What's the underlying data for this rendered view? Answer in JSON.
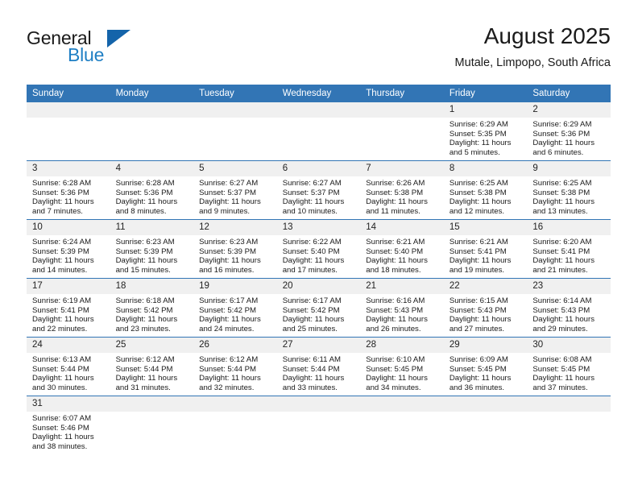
{
  "brand": {
    "word_general": "General",
    "word_blue": "Blue",
    "logo_icon": "triangle-logo-icon",
    "accent_color": "#1f7fc4",
    "triangle_color": "#1464aa"
  },
  "header": {
    "title": "August 2025",
    "subtitle": "Mutale, Limpopo, South Africa"
  },
  "theme": {
    "header_row_bg": "#3275b5",
    "daynum_bg": "#f0f0f0",
    "row_divider": "#3275b5"
  },
  "weekday_headers": [
    "Sunday",
    "Monday",
    "Tuesday",
    "Wednesday",
    "Thursday",
    "Friday",
    "Saturday"
  ],
  "weeks": [
    [
      {
        "day": "",
        "lines": []
      },
      {
        "day": "",
        "lines": []
      },
      {
        "day": "",
        "lines": []
      },
      {
        "day": "",
        "lines": []
      },
      {
        "day": "",
        "lines": []
      },
      {
        "day": "1",
        "lines": [
          "Sunrise: 6:29 AM",
          "Sunset: 5:35 PM",
          "Daylight: 11 hours",
          "and 5 minutes."
        ]
      },
      {
        "day": "2",
        "lines": [
          "Sunrise: 6:29 AM",
          "Sunset: 5:36 PM",
          "Daylight: 11 hours",
          "and 6 minutes."
        ]
      }
    ],
    [
      {
        "day": "3",
        "lines": [
          "Sunrise: 6:28 AM",
          "Sunset: 5:36 PM",
          "Daylight: 11 hours",
          "and 7 minutes."
        ]
      },
      {
        "day": "4",
        "lines": [
          "Sunrise: 6:28 AM",
          "Sunset: 5:36 PM",
          "Daylight: 11 hours",
          "and 8 minutes."
        ]
      },
      {
        "day": "5",
        "lines": [
          "Sunrise: 6:27 AM",
          "Sunset: 5:37 PM",
          "Daylight: 11 hours",
          "and 9 minutes."
        ]
      },
      {
        "day": "6",
        "lines": [
          "Sunrise: 6:27 AM",
          "Sunset: 5:37 PM",
          "Daylight: 11 hours",
          "and 10 minutes."
        ]
      },
      {
        "day": "7",
        "lines": [
          "Sunrise: 6:26 AM",
          "Sunset: 5:38 PM",
          "Daylight: 11 hours",
          "and 11 minutes."
        ]
      },
      {
        "day": "8",
        "lines": [
          "Sunrise: 6:25 AM",
          "Sunset: 5:38 PM",
          "Daylight: 11 hours",
          "and 12 minutes."
        ]
      },
      {
        "day": "9",
        "lines": [
          "Sunrise: 6:25 AM",
          "Sunset: 5:38 PM",
          "Daylight: 11 hours",
          "and 13 minutes."
        ]
      }
    ],
    [
      {
        "day": "10",
        "lines": [
          "Sunrise: 6:24 AM",
          "Sunset: 5:39 PM",
          "Daylight: 11 hours",
          "and 14 minutes."
        ]
      },
      {
        "day": "11",
        "lines": [
          "Sunrise: 6:23 AM",
          "Sunset: 5:39 PM",
          "Daylight: 11 hours",
          "and 15 minutes."
        ]
      },
      {
        "day": "12",
        "lines": [
          "Sunrise: 6:23 AM",
          "Sunset: 5:39 PM",
          "Daylight: 11 hours",
          "and 16 minutes."
        ]
      },
      {
        "day": "13",
        "lines": [
          "Sunrise: 6:22 AM",
          "Sunset: 5:40 PM",
          "Daylight: 11 hours",
          "and 17 minutes."
        ]
      },
      {
        "day": "14",
        "lines": [
          "Sunrise: 6:21 AM",
          "Sunset: 5:40 PM",
          "Daylight: 11 hours",
          "and 18 minutes."
        ]
      },
      {
        "day": "15",
        "lines": [
          "Sunrise: 6:21 AM",
          "Sunset: 5:41 PM",
          "Daylight: 11 hours",
          "and 19 minutes."
        ]
      },
      {
        "day": "16",
        "lines": [
          "Sunrise: 6:20 AM",
          "Sunset: 5:41 PM",
          "Daylight: 11 hours",
          "and 21 minutes."
        ]
      }
    ],
    [
      {
        "day": "17",
        "lines": [
          "Sunrise: 6:19 AM",
          "Sunset: 5:41 PM",
          "Daylight: 11 hours",
          "and 22 minutes."
        ]
      },
      {
        "day": "18",
        "lines": [
          "Sunrise: 6:18 AM",
          "Sunset: 5:42 PM",
          "Daylight: 11 hours",
          "and 23 minutes."
        ]
      },
      {
        "day": "19",
        "lines": [
          "Sunrise: 6:17 AM",
          "Sunset: 5:42 PM",
          "Daylight: 11 hours",
          "and 24 minutes."
        ]
      },
      {
        "day": "20",
        "lines": [
          "Sunrise: 6:17 AM",
          "Sunset: 5:42 PM",
          "Daylight: 11 hours",
          "and 25 minutes."
        ]
      },
      {
        "day": "21",
        "lines": [
          "Sunrise: 6:16 AM",
          "Sunset: 5:43 PM",
          "Daylight: 11 hours",
          "and 26 minutes."
        ]
      },
      {
        "day": "22",
        "lines": [
          "Sunrise: 6:15 AM",
          "Sunset: 5:43 PM",
          "Daylight: 11 hours",
          "and 27 minutes."
        ]
      },
      {
        "day": "23",
        "lines": [
          "Sunrise: 6:14 AM",
          "Sunset: 5:43 PM",
          "Daylight: 11 hours",
          "and 29 minutes."
        ]
      }
    ],
    [
      {
        "day": "24",
        "lines": [
          "Sunrise: 6:13 AM",
          "Sunset: 5:44 PM",
          "Daylight: 11 hours",
          "and 30 minutes."
        ]
      },
      {
        "day": "25",
        "lines": [
          "Sunrise: 6:12 AM",
          "Sunset: 5:44 PM",
          "Daylight: 11 hours",
          "and 31 minutes."
        ]
      },
      {
        "day": "26",
        "lines": [
          "Sunrise: 6:12 AM",
          "Sunset: 5:44 PM",
          "Daylight: 11 hours",
          "and 32 minutes."
        ]
      },
      {
        "day": "27",
        "lines": [
          "Sunrise: 6:11 AM",
          "Sunset: 5:44 PM",
          "Daylight: 11 hours",
          "and 33 minutes."
        ]
      },
      {
        "day": "28",
        "lines": [
          "Sunrise: 6:10 AM",
          "Sunset: 5:45 PM",
          "Daylight: 11 hours",
          "and 34 minutes."
        ]
      },
      {
        "day": "29",
        "lines": [
          "Sunrise: 6:09 AM",
          "Sunset: 5:45 PM",
          "Daylight: 11 hours",
          "and 36 minutes."
        ]
      },
      {
        "day": "30",
        "lines": [
          "Sunrise: 6:08 AM",
          "Sunset: 5:45 PM",
          "Daylight: 11 hours",
          "and 37 minutes."
        ]
      }
    ],
    [
      {
        "day": "31",
        "lines": [
          "Sunrise: 6:07 AM",
          "Sunset: 5:46 PM",
          "Daylight: 11 hours",
          "and 38 minutes."
        ]
      },
      {
        "day": "",
        "lines": []
      },
      {
        "day": "",
        "lines": []
      },
      {
        "day": "",
        "lines": []
      },
      {
        "day": "",
        "lines": []
      },
      {
        "day": "",
        "lines": []
      },
      {
        "day": "",
        "lines": []
      }
    ]
  ]
}
